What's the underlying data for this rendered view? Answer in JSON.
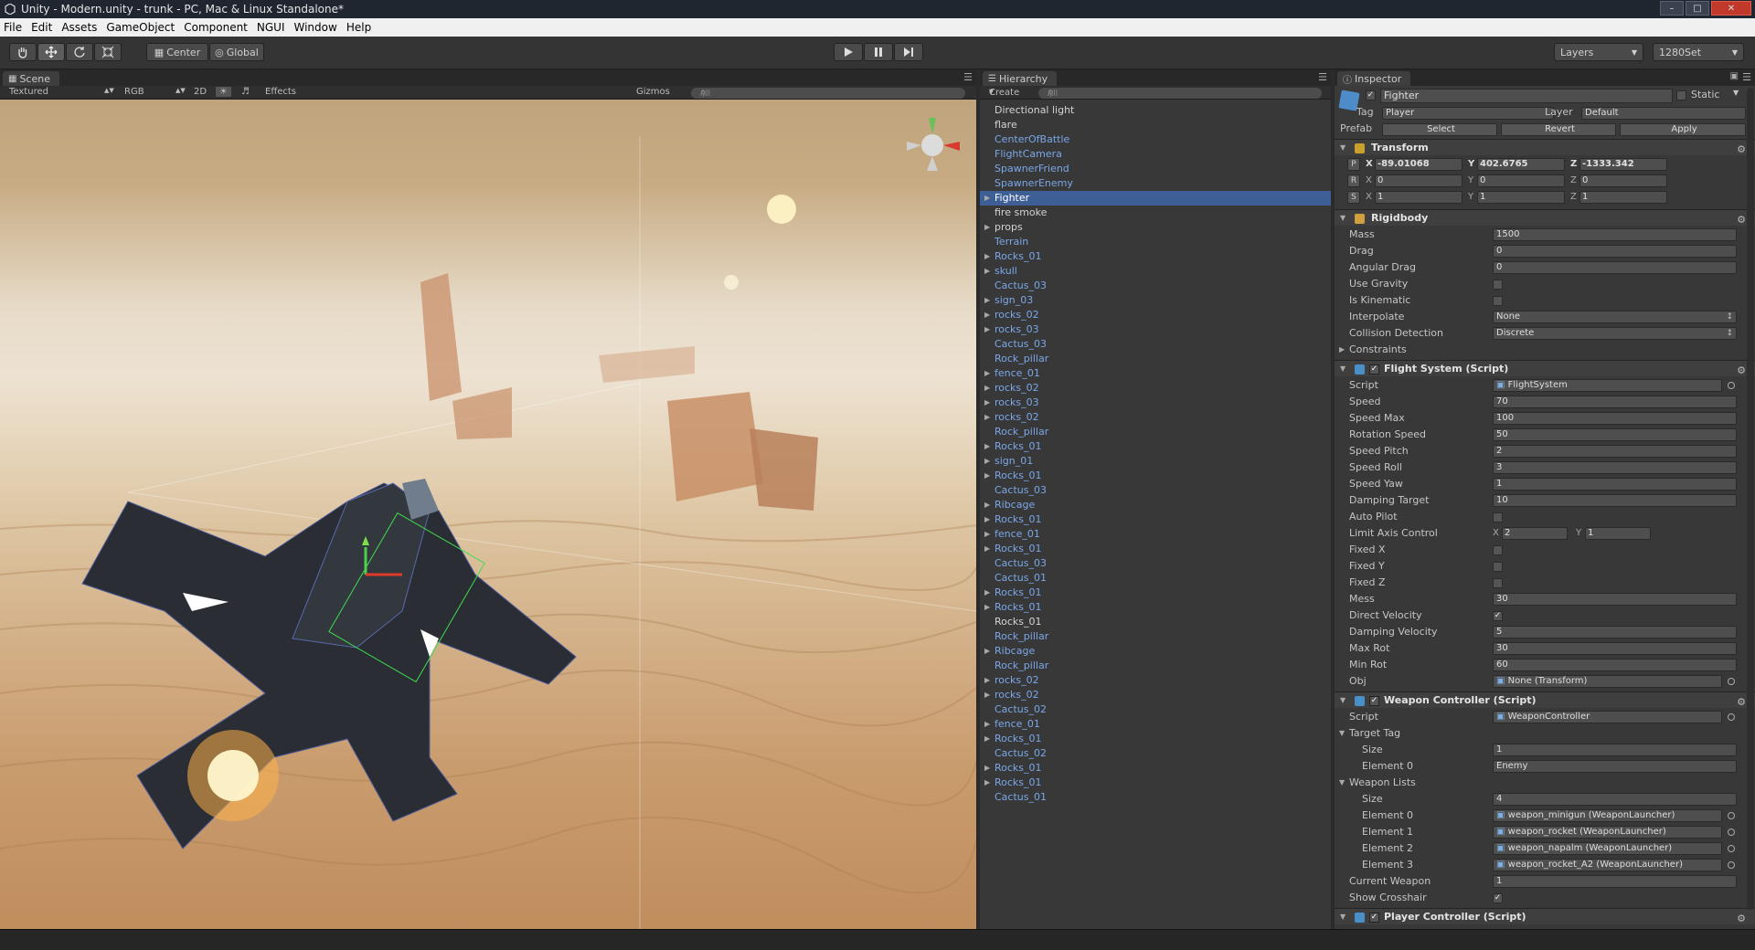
{
  "window": {
    "title": "Unity - Modern.unity - trunk - PC, Mac & Linux Standalone*"
  },
  "menu": [
    "File",
    "Edit",
    "Assets",
    "GameObject",
    "Component",
    "NGUI",
    "Window",
    "Help"
  ],
  "toolbar": {
    "pivot": "Center",
    "space": "Global",
    "layers": "Layers",
    "layout": "1280Set"
  },
  "scene": {
    "tab": "Scene",
    "draw_mode": "Textured",
    "render_mode": "RGB",
    "mode_2d": "2D",
    "effects": "Effects",
    "gizmos": "Gizmos",
    "search": "All"
  },
  "hierarchy": {
    "tab": "Hierarchy",
    "create": "Create",
    "search": "All",
    "items": [
      {
        "name": "Directional light",
        "arrow": false,
        "style": "plain"
      },
      {
        "name": "flare",
        "arrow": false,
        "style": "plain"
      },
      {
        "name": "CenterOfBattle",
        "arrow": false,
        "style": "prefab"
      },
      {
        "name": "FlightCamera",
        "arrow": false,
        "style": "prefab"
      },
      {
        "name": "SpawnerFriend",
        "arrow": false,
        "style": "prefab"
      },
      {
        "name": "SpawnerEnemy",
        "arrow": false,
        "style": "prefab"
      },
      {
        "name": "Fighter",
        "arrow": true,
        "style": "selected"
      },
      {
        "name": "fire smoke",
        "arrow": false,
        "style": "plain"
      },
      {
        "name": "props",
        "arrow": true,
        "style": "plain"
      },
      {
        "name": "Terrain",
        "arrow": false,
        "style": "prefab"
      },
      {
        "name": "Rocks_01",
        "arrow": true,
        "style": "prefab"
      },
      {
        "name": "skull",
        "arrow": true,
        "style": "prefab"
      },
      {
        "name": "Cactus_03",
        "arrow": false,
        "style": "prefab"
      },
      {
        "name": "sign_03",
        "arrow": true,
        "style": "prefab"
      },
      {
        "name": "rocks_02",
        "arrow": true,
        "style": "prefab"
      },
      {
        "name": "rocks_03",
        "arrow": true,
        "style": "prefab"
      },
      {
        "name": "Cactus_03",
        "arrow": false,
        "style": "prefab"
      },
      {
        "name": "Rock_pillar",
        "arrow": false,
        "style": "prefab"
      },
      {
        "name": "fence_01",
        "arrow": true,
        "style": "prefab"
      },
      {
        "name": "rocks_02",
        "arrow": true,
        "style": "prefab"
      },
      {
        "name": "rocks_03",
        "arrow": true,
        "style": "prefab"
      },
      {
        "name": "rocks_02",
        "arrow": true,
        "style": "prefab"
      },
      {
        "name": "Rock_pillar",
        "arrow": false,
        "style": "prefab"
      },
      {
        "name": "Rocks_01",
        "arrow": true,
        "style": "prefab"
      },
      {
        "name": "sign_01",
        "arrow": true,
        "style": "prefab"
      },
      {
        "name": "Rocks_01",
        "arrow": true,
        "style": "prefab"
      },
      {
        "name": "Cactus_03",
        "arrow": false,
        "style": "prefab"
      },
      {
        "name": "Ribcage",
        "arrow": true,
        "style": "prefab"
      },
      {
        "name": "Rocks_01",
        "arrow": true,
        "style": "prefab"
      },
      {
        "name": "fence_01",
        "arrow": true,
        "style": "prefab"
      },
      {
        "name": "Rocks_01",
        "arrow": true,
        "style": "prefab"
      },
      {
        "name": "Cactus_03",
        "arrow": false,
        "style": "prefab"
      },
      {
        "name": "Cactus_01",
        "arrow": false,
        "style": "prefab"
      },
      {
        "name": "Rocks_01",
        "arrow": true,
        "style": "prefab"
      },
      {
        "name": "Rocks_01",
        "arrow": true,
        "style": "prefab"
      },
      {
        "name": "Rocks_01",
        "arrow": false,
        "style": "plain"
      },
      {
        "name": "Rock_pillar",
        "arrow": false,
        "style": "prefab"
      },
      {
        "name": "Ribcage",
        "arrow": true,
        "style": "prefab"
      },
      {
        "name": "Rock_pillar",
        "arrow": false,
        "style": "prefab"
      },
      {
        "name": "rocks_02",
        "arrow": true,
        "style": "prefab"
      },
      {
        "name": "rocks_02",
        "arrow": true,
        "style": "prefab"
      },
      {
        "name": "Cactus_02",
        "arrow": false,
        "style": "prefab"
      },
      {
        "name": "fence_01",
        "arrow": true,
        "style": "prefab"
      },
      {
        "name": "Rocks_01",
        "arrow": true,
        "style": "prefab"
      },
      {
        "name": "Cactus_02",
        "arrow": false,
        "style": "prefab"
      },
      {
        "name": "Rocks_01",
        "arrow": true,
        "style": "prefab"
      },
      {
        "name": "Rocks_01",
        "arrow": true,
        "style": "prefab"
      },
      {
        "name": "Cactus_01",
        "arrow": false,
        "style": "prefab"
      }
    ]
  },
  "inspector": {
    "tab": "Inspector",
    "object_name": "Fighter",
    "static_label": "Static",
    "tag_label": "Tag",
    "tag_value": "Player",
    "layer_label": "Layer",
    "layer_value": "Default",
    "prefab_label": "Prefab",
    "prefab_select": "Select",
    "prefab_revert": "Revert",
    "prefab_apply": "Apply",
    "transform": {
      "title": "Transform",
      "rows": [
        {
          "key": "P",
          "x": "-89.01068",
          "y": "402.6765",
          "z": "-1333.342"
        },
        {
          "key": "R",
          "x": "0",
          "y": "0",
          "z": "0"
        },
        {
          "key": "S",
          "x": "1",
          "y": "1",
          "z": "1"
        }
      ]
    },
    "rigidbody": {
      "title": "Rigidbody",
      "rows": [
        {
          "label": "Mass",
          "type": "value",
          "value": "1500"
        },
        {
          "label": "Drag",
          "type": "value",
          "value": "0"
        },
        {
          "label": "Angular Drag",
          "type": "value",
          "value": "0"
        },
        {
          "label": "Use Gravity",
          "type": "check",
          "checked": false
        },
        {
          "label": "Is Kinematic",
          "type": "check",
          "checked": false
        },
        {
          "label": "Interpolate",
          "type": "select",
          "value": "None"
        },
        {
          "label": "Collision Detection",
          "type": "select",
          "value": "Discrete"
        },
        {
          "label": "Constraints",
          "type": "foldout"
        }
      ]
    },
    "flight_system": {
      "title": "Flight System (Script)",
      "rows": [
        {
          "label": "Script",
          "type": "object",
          "value": "FlightSystem"
        },
        {
          "label": "Speed",
          "type": "value",
          "value": "70"
        },
        {
          "label": "Speed Max",
          "type": "value",
          "value": "100"
        },
        {
          "label": "Rotation Speed",
          "type": "value",
          "value": "50"
        },
        {
          "label": "Speed Pitch",
          "type": "value",
          "value": "2"
        },
        {
          "label": "Speed Roll",
          "type": "value",
          "value": "3"
        },
        {
          "label": "Speed Yaw",
          "type": "value",
          "value": "1"
        },
        {
          "label": "Damping Target",
          "type": "value",
          "value": "10"
        },
        {
          "label": "Auto Pilot",
          "type": "check",
          "checked": false
        },
        {
          "label": "Limit Axis Control",
          "type": "xy",
          "x": "2",
          "y": "1"
        },
        {
          "label": "Fixed X",
          "type": "check",
          "checked": false
        },
        {
          "label": "Fixed Y",
          "type": "check",
          "checked": false
        },
        {
          "label": "Fixed Z",
          "type": "check",
          "checked": false
        },
        {
          "label": "Mess",
          "type": "value",
          "value": "30"
        },
        {
          "label": "Direct Velocity",
          "type": "check",
          "checked": true
        },
        {
          "label": "Damping Velocity",
          "type": "value",
          "value": "5"
        },
        {
          "label": "Max Rot",
          "type": "value",
          "value": "30"
        },
        {
          "label": "Min Rot",
          "type": "value",
          "value": "60"
        },
        {
          "label": "Obj",
          "type": "object",
          "value": "None (Transform)"
        }
      ]
    },
    "weapon_controller": {
      "title": "Weapon Controller (Script)",
      "rows": [
        {
          "label": "Script",
          "type": "object",
          "value": "WeaponController",
          "indent": 0
        },
        {
          "label": "Target Tag",
          "type": "foldopen",
          "indent": 0
        },
        {
          "label": "Size",
          "type": "value",
          "value": "1",
          "indent": 1
        },
        {
          "label": "Element 0",
          "type": "value",
          "value": "Enemy",
          "indent": 1
        },
        {
          "label": "Weapon Lists",
          "type": "foldopen",
          "indent": 0
        },
        {
          "label": "Size",
          "type": "value",
          "value": "4",
          "indent": 1
        },
        {
          "label": "Element 0",
          "type": "object",
          "value": "weapon_minigun (WeaponLauncher)",
          "indent": 1
        },
        {
          "label": "Element 1",
          "type": "object",
          "value": "weapon_rocket (WeaponLauncher)",
          "indent": 1
        },
        {
          "label": "Element 2",
          "type": "object",
          "value": "weapon_napalm (WeaponLauncher)",
          "indent": 1
        },
        {
          "label": "Element 3",
          "type": "object",
          "value": "weapon_rocket_A2 (WeaponLauncher)",
          "indent": 1
        },
        {
          "label": "Current Weapon",
          "type": "value",
          "value": "1",
          "indent": 0
        },
        {
          "label": "Show Crosshair",
          "type": "check",
          "checked": true,
          "indent": 0
        }
      ]
    },
    "player_controller": {
      "title": "Player Controller (Script)"
    }
  }
}
